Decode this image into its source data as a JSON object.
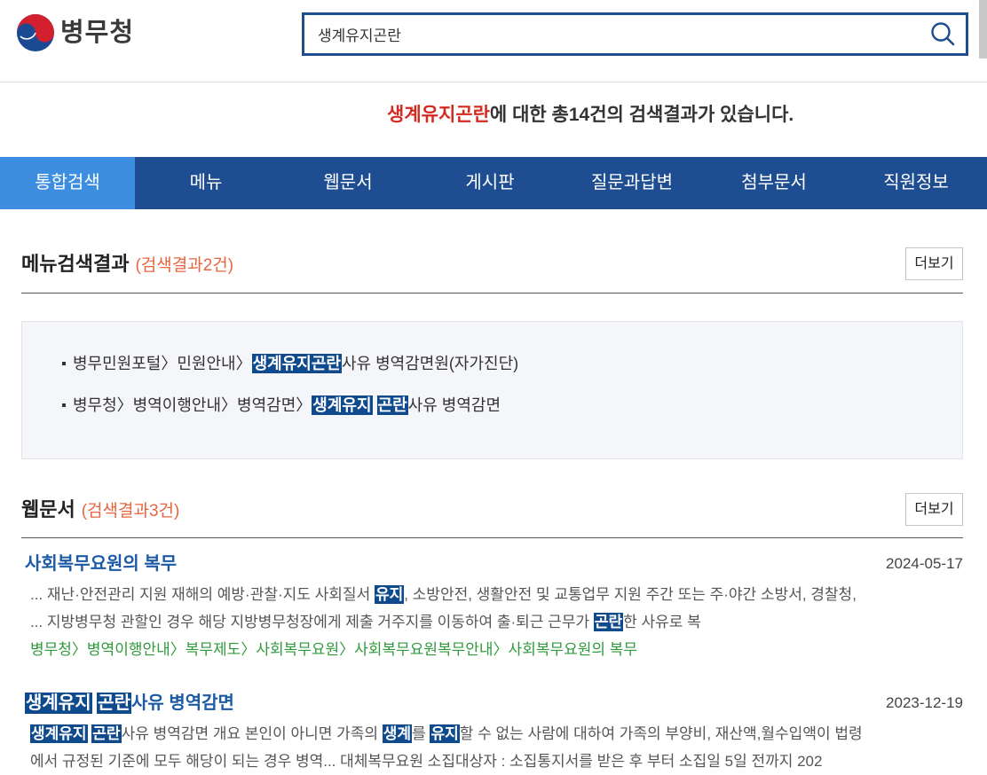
{
  "header": {
    "logo": {
      "text": "병무청",
      "icon": "government-emblem-icon"
    },
    "search": {
      "value": "생계유지곤란",
      "button_icon": "search-icon"
    }
  },
  "summary": {
    "keyword": "생계유지곤란",
    "text": "에 대한 총14건의 검색결과가 있습니다."
  },
  "tabs": [
    {
      "label": "통합검색",
      "active": true
    },
    {
      "label": "메뉴"
    },
    {
      "label": "웹문서"
    },
    {
      "label": "게시판"
    },
    {
      "label": "질문과답변"
    },
    {
      "label": "첨부문서"
    },
    {
      "label": "직원정보"
    }
  ],
  "menu_results": {
    "title": "메뉴검색결과",
    "count": "(검색결과2건)",
    "more_label": "더보기",
    "items": [
      {
        "segments": [
          {
            "t": "병무민원포털〉민원안내〉"
          },
          {
            "t": "생계유지곤란",
            "hl": true
          },
          {
            "t": "사유 병역감면원(자가진단)"
          }
        ]
      },
      {
        "segments": [
          {
            "t": "병무청〉병역이행안내〉병역감면〉"
          },
          {
            "t": "생계유지",
            "hl": true
          },
          {
            "t": "곤란",
            "hl": true
          },
          {
            "t": "사유 병역감면"
          }
        ]
      }
    ]
  },
  "web_results": {
    "title": "웹문서",
    "count": "(검색결과3건)",
    "more_label": "더보기",
    "results": [
      {
        "title": [
          {
            "t": "사회복무요원의 복무"
          }
        ],
        "date": "2024-05-17",
        "snippet": [
          [
            {
              "t": "... 재난·안전관리 지원 재해의 예방·관찰·지도 사회질서 "
            },
            {
              "t": "유지",
              "hl": true
            },
            {
              "t": ", 소방안전, 생활안전 및 교통업무 지원 주간 또는 주·야간 소방서, 경찰청,"
            }
          ],
          [
            {
              "t": "... 지방병무청 관할인 경우 해당 지방병무청장에게 제출 거주지를 이동하여 출·퇴근 근무가 "
            },
            {
              "t": "곤란",
              "hl": true
            },
            {
              "t": "한 사유로 복"
            }
          ]
        ],
        "path": "병무청〉병역이행안내〉복무제도〉사회복무요원〉사회복무요원복무안내〉사회복무요원의 복무"
      },
      {
        "title": [
          {
            "t": "생계유지",
            "hl": true
          },
          {
            "t": "곤란",
            "hl": true
          },
          {
            "t": "사유 병역감면"
          }
        ],
        "date": "2023-12-19",
        "snippet": [
          [
            {
              "t": "생계유지",
              "hl": true
            },
            {
              "t": "곤란",
              "hl": true
            },
            {
              "t": "사유 병역감면 개요 본인이 아니면 가족의 "
            },
            {
              "t": "생계",
              "hl": true
            },
            {
              "t": "를 "
            },
            {
              "t": "유지",
              "hl": true
            },
            {
              "t": "할 수 없는 사람에 대하여 가족의 부양비, 재산액,월수입액이 법령"
            }
          ],
          [
            {
              "t": "에서 규정된 기준에 모두 해당이 되는 경우 병역... 대체복무요원 소집대상자 : 소집통지서를 받은 후 부터 소집일 5일 전까지 202"
            }
          ]
        ]
      }
    ]
  },
  "colors": {
    "tab_bar": "#1e4e91",
    "tab_active": "#3d8ee0",
    "keyword": "#d42a1f",
    "count": "#e8653f",
    "title_link": "#1c5aa6",
    "path": "#2f9a3c",
    "highlight_bg": "#0f4a8d",
    "search_border": "#1d4e8e"
  }
}
